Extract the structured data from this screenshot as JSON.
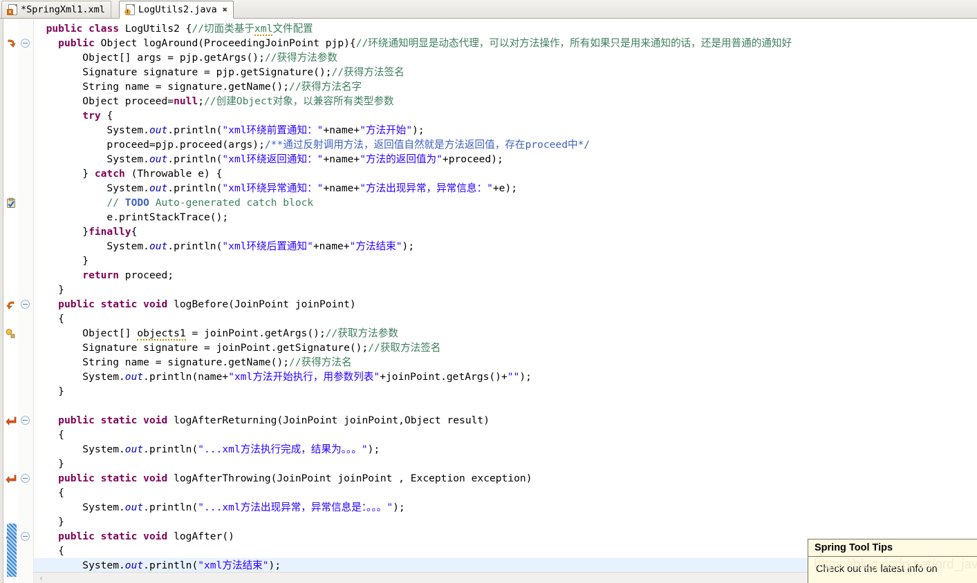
{
  "window": {
    "app": "Eclipse Java Editor"
  },
  "tabs": [
    {
      "label": "*SpringXml1.xml",
      "icon": "xml-file-icon",
      "active": false,
      "dirty": true,
      "closeable": false
    },
    {
      "label": "LogUtils2.java",
      "icon": "java-file-warning-icon",
      "active": true,
      "dirty": false,
      "closeable": true,
      "close_glyph": "✖"
    }
  ],
  "editor": {
    "file": "LogUtils2.java",
    "highlighted_line_index": 37,
    "colors": {
      "keyword": "#7F0055",
      "string": "#2A00FF",
      "line_comment": "#3F7F5F",
      "javadoc": "#3F5FBF",
      "field": "#0000C0",
      "plain": "#000000",
      "current_line": "#E8F2FE",
      "background": "#FFFFFF"
    },
    "lines": [
      [
        {
          "t": "  ",
          "c": "pln"
        },
        {
          "t": "public class ",
          "c": "kw"
        },
        {
          "t": "LogUtils2 {",
          "c": "pln"
        },
        {
          "t": "//切面类基于",
          "c": "cmt"
        },
        {
          "t": "xml",
          "c": "cmt squig"
        },
        {
          "t": "文件配置",
          "c": "cmt"
        }
      ],
      [
        {
          "t": "    ",
          "c": "pln"
        },
        {
          "t": "public ",
          "c": "kw"
        },
        {
          "t": "Object logAround(ProceedingJoinPoint pjp){",
          "c": "pln"
        },
        {
          "t": "//环绕通知明显是动态代理，可以对方法操作，所有如果只是用来通知的话，还是用普通的通知好",
          "c": "cmt"
        }
      ],
      [
        {
          "t": "        Object[] args = pjp.getArgs();",
          "c": "pln"
        },
        {
          "t": "//获得方法参数",
          "c": "cmt"
        }
      ],
      [
        {
          "t": "        Signature signature = pjp.getSignature();",
          "c": "pln"
        },
        {
          "t": "//获得方法签名",
          "c": "cmt"
        }
      ],
      [
        {
          "t": "        String name = signature.getName();",
          "c": "pln"
        },
        {
          "t": "//获得方法名字",
          "c": "cmt"
        }
      ],
      [
        {
          "t": "        Object proceed=",
          "c": "pln"
        },
        {
          "t": "null",
          "c": "kw"
        },
        {
          "t": ";",
          "c": "pln"
        },
        {
          "t": "//创建Object对象，以兼容所有类型参数",
          "c": "cmt"
        }
      ],
      [
        {
          "t": "        ",
          "c": "pln"
        },
        {
          "t": "try",
          "c": "kw"
        },
        {
          "t": " {",
          "c": "pln"
        }
      ],
      [
        {
          "t": "            System.",
          "c": "pln"
        },
        {
          "t": "out",
          "c": "fld"
        },
        {
          "t": ".println(",
          "c": "pln"
        },
        {
          "t": "\"xml环绕前置通知：\"",
          "c": "str"
        },
        {
          "t": "+name+",
          "c": "pln"
        },
        {
          "t": "\"方法开始\"",
          "c": "str"
        },
        {
          "t": ");",
          "c": "pln"
        }
      ],
      [
        {
          "t": "            proceed=pjp.proceed(args);",
          "c": "pln"
        },
        {
          "t": "/**通过反射调用方法，返回值自然就是方法返回值，存在proceed中*/",
          "c": "doc"
        }
      ],
      [
        {
          "t": "            System.",
          "c": "pln"
        },
        {
          "t": "out",
          "c": "fld"
        },
        {
          "t": ".println(",
          "c": "pln"
        },
        {
          "t": "\"xml环绕返回通知：\"",
          "c": "str"
        },
        {
          "t": "+name+",
          "c": "pln"
        },
        {
          "t": "\"方法的返回值为\"",
          "c": "str"
        },
        {
          "t": "+proceed);",
          "c": "pln"
        }
      ],
      [
        {
          "t": "        } ",
          "c": "pln"
        },
        {
          "t": "catch",
          "c": "kw"
        },
        {
          "t": " (Throwable e) {",
          "c": "pln"
        }
      ],
      [
        {
          "t": "            System.",
          "c": "pln"
        },
        {
          "t": "out",
          "c": "fld"
        },
        {
          "t": ".println(",
          "c": "pln"
        },
        {
          "t": "\"xml环绕异常通知：\"",
          "c": "str"
        },
        {
          "t": "+name+",
          "c": "pln"
        },
        {
          "t": "\"方法出现异常，异常信息：\"",
          "c": "str"
        },
        {
          "t": "+e);",
          "c": "pln"
        }
      ],
      [
        {
          "t": "            ",
          "c": "pln"
        },
        {
          "t": "// ",
          "c": "cmt"
        },
        {
          "t": "TODO",
          "c": "todo"
        },
        {
          "t": " Auto-generated catch block",
          "c": "cmt"
        }
      ],
      [
        {
          "t": "            e.printStackTrace();",
          "c": "pln"
        }
      ],
      [
        {
          "t": "        }",
          "c": "pln"
        },
        {
          "t": "finally",
          "c": "kw"
        },
        {
          "t": "{",
          "c": "pln"
        }
      ],
      [
        {
          "t": "            System.",
          "c": "pln"
        },
        {
          "t": "out",
          "c": "fld"
        },
        {
          "t": ".println(",
          "c": "pln"
        },
        {
          "t": "\"xml环绕后置通知\"",
          "c": "str"
        },
        {
          "t": "+name+",
          "c": "pln"
        },
        {
          "t": "\"方法结束\"",
          "c": "str"
        },
        {
          "t": ");",
          "c": "pln"
        }
      ],
      [
        {
          "t": "        }",
          "c": "pln"
        }
      ],
      [
        {
          "t": "        ",
          "c": "pln"
        },
        {
          "t": "return",
          "c": "kw"
        },
        {
          "t": " proceed;",
          "c": "pln"
        }
      ],
      [
        {
          "t": "    }",
          "c": "pln"
        }
      ],
      [
        {
          "t": "    ",
          "c": "pln"
        },
        {
          "t": "public static void ",
          "c": "kw"
        },
        {
          "t": "logBefore(JoinPoint joinPoint)",
          "c": "pln"
        }
      ],
      [
        {
          "t": "    {",
          "c": "pln"
        }
      ],
      [
        {
          "t": "        Object[] ",
          "c": "pln"
        },
        {
          "t": "objects1",
          "c": "pln squig"
        },
        {
          "t": " = joinPoint.getArgs();",
          "c": "pln"
        },
        {
          "t": "//获取方法参数",
          "c": "cmt"
        }
      ],
      [
        {
          "t": "        Signature signature = joinPoint.getSignature();",
          "c": "pln"
        },
        {
          "t": "//获取方法签名",
          "c": "cmt"
        }
      ],
      [
        {
          "t": "        String name = signature.getName();",
          "c": "pln"
        },
        {
          "t": "//获得方法名",
          "c": "cmt"
        }
      ],
      [
        {
          "t": "        System.",
          "c": "pln"
        },
        {
          "t": "out",
          "c": "fld"
        },
        {
          "t": ".println(name+",
          "c": "pln"
        },
        {
          "t": "\"xml方法开始执行，用参数列表\"",
          "c": "str"
        },
        {
          "t": "+joinPoint.getArgs()+",
          "c": "pln"
        },
        {
          "t": "\"\"",
          "c": "str"
        },
        {
          "t": ");",
          "c": "pln"
        }
      ],
      [
        {
          "t": "    }",
          "c": "pln"
        }
      ],
      [
        {
          "t": "",
          "c": "pln"
        }
      ],
      [
        {
          "t": "    ",
          "c": "pln"
        },
        {
          "t": "public static void ",
          "c": "kw"
        },
        {
          "t": "logAfterReturning(JoinPoint joinPoint,Object result)",
          "c": "pln"
        }
      ],
      [
        {
          "t": "    {",
          "c": "pln"
        }
      ],
      [
        {
          "t": "        System.",
          "c": "pln"
        },
        {
          "t": "out",
          "c": "fld"
        },
        {
          "t": ".println(",
          "c": "pln"
        },
        {
          "t": "\"...xml方法执行完成，结果为。。。\"",
          "c": "str"
        },
        {
          "t": ");",
          "c": "pln"
        }
      ],
      [
        {
          "t": "    }",
          "c": "pln"
        }
      ],
      [
        {
          "t": "    ",
          "c": "pln"
        },
        {
          "t": "public static void ",
          "c": "kw"
        },
        {
          "t": "logAfterThrowing(JoinPoint joinPoint , Exception exception)",
          "c": "pln"
        }
      ],
      [
        {
          "t": "    {",
          "c": "pln"
        }
      ],
      [
        {
          "t": "        System.",
          "c": "pln"
        },
        {
          "t": "out",
          "c": "fld"
        },
        {
          "t": ".println(",
          "c": "pln"
        },
        {
          "t": "\"...xml方法出现异常，异常信息是：。。。\"",
          "c": "str"
        },
        {
          "t": ");",
          "c": "pln"
        }
      ],
      [
        {
          "t": "    }",
          "c": "pln"
        }
      ],
      [
        {
          "t": "    ",
          "c": "pln"
        },
        {
          "t": "public static void ",
          "c": "kw"
        },
        {
          "t": "logAfter()",
          "c": "pln"
        }
      ],
      [
        {
          "t": "    {",
          "c": "pln"
        }
      ],
      [
        {
          "t": "        System.",
          "c": "pln"
        },
        {
          "t": "out",
          "c": "fld"
        },
        {
          "t": ".println(",
          "c": "pln"
        },
        {
          "t": "\"xml方法结束\"",
          "c": "str"
        },
        {
          "t": ");",
          "c": "pln"
        }
      ]
    ],
    "fold_widgets": [
      1,
      19,
      27,
      31,
      35
    ],
    "markers": [
      {
        "line": 1,
        "icon": "spring-bean-marker-icon",
        "kind": "spring"
      },
      {
        "line": 12,
        "icon": "task-todo-marker-icon",
        "kind": "todo"
      },
      {
        "line": 19,
        "icon": "spring-override-marker-icon",
        "kind": "override"
      },
      {
        "line": 21,
        "icon": "warning-marker-icon",
        "kind": "warning"
      },
      {
        "line": 27,
        "icon": "spring-return-marker-icon",
        "kind": "return"
      },
      {
        "line": 31,
        "icon": "spring-return-marker-icon",
        "kind": "return"
      },
      {
        "line": 35,
        "icon": "spring-return-marker-icon",
        "kind": "return"
      }
    ]
  },
  "scrollbar": {
    "left_arrow_glyph": "‹"
  },
  "popup": {
    "title": "Spring Tool Tips",
    "body": "Check out the latest info on"
  },
  "watermark": {
    "text": "https://blog.csdn.net/qrd_java"
  }
}
